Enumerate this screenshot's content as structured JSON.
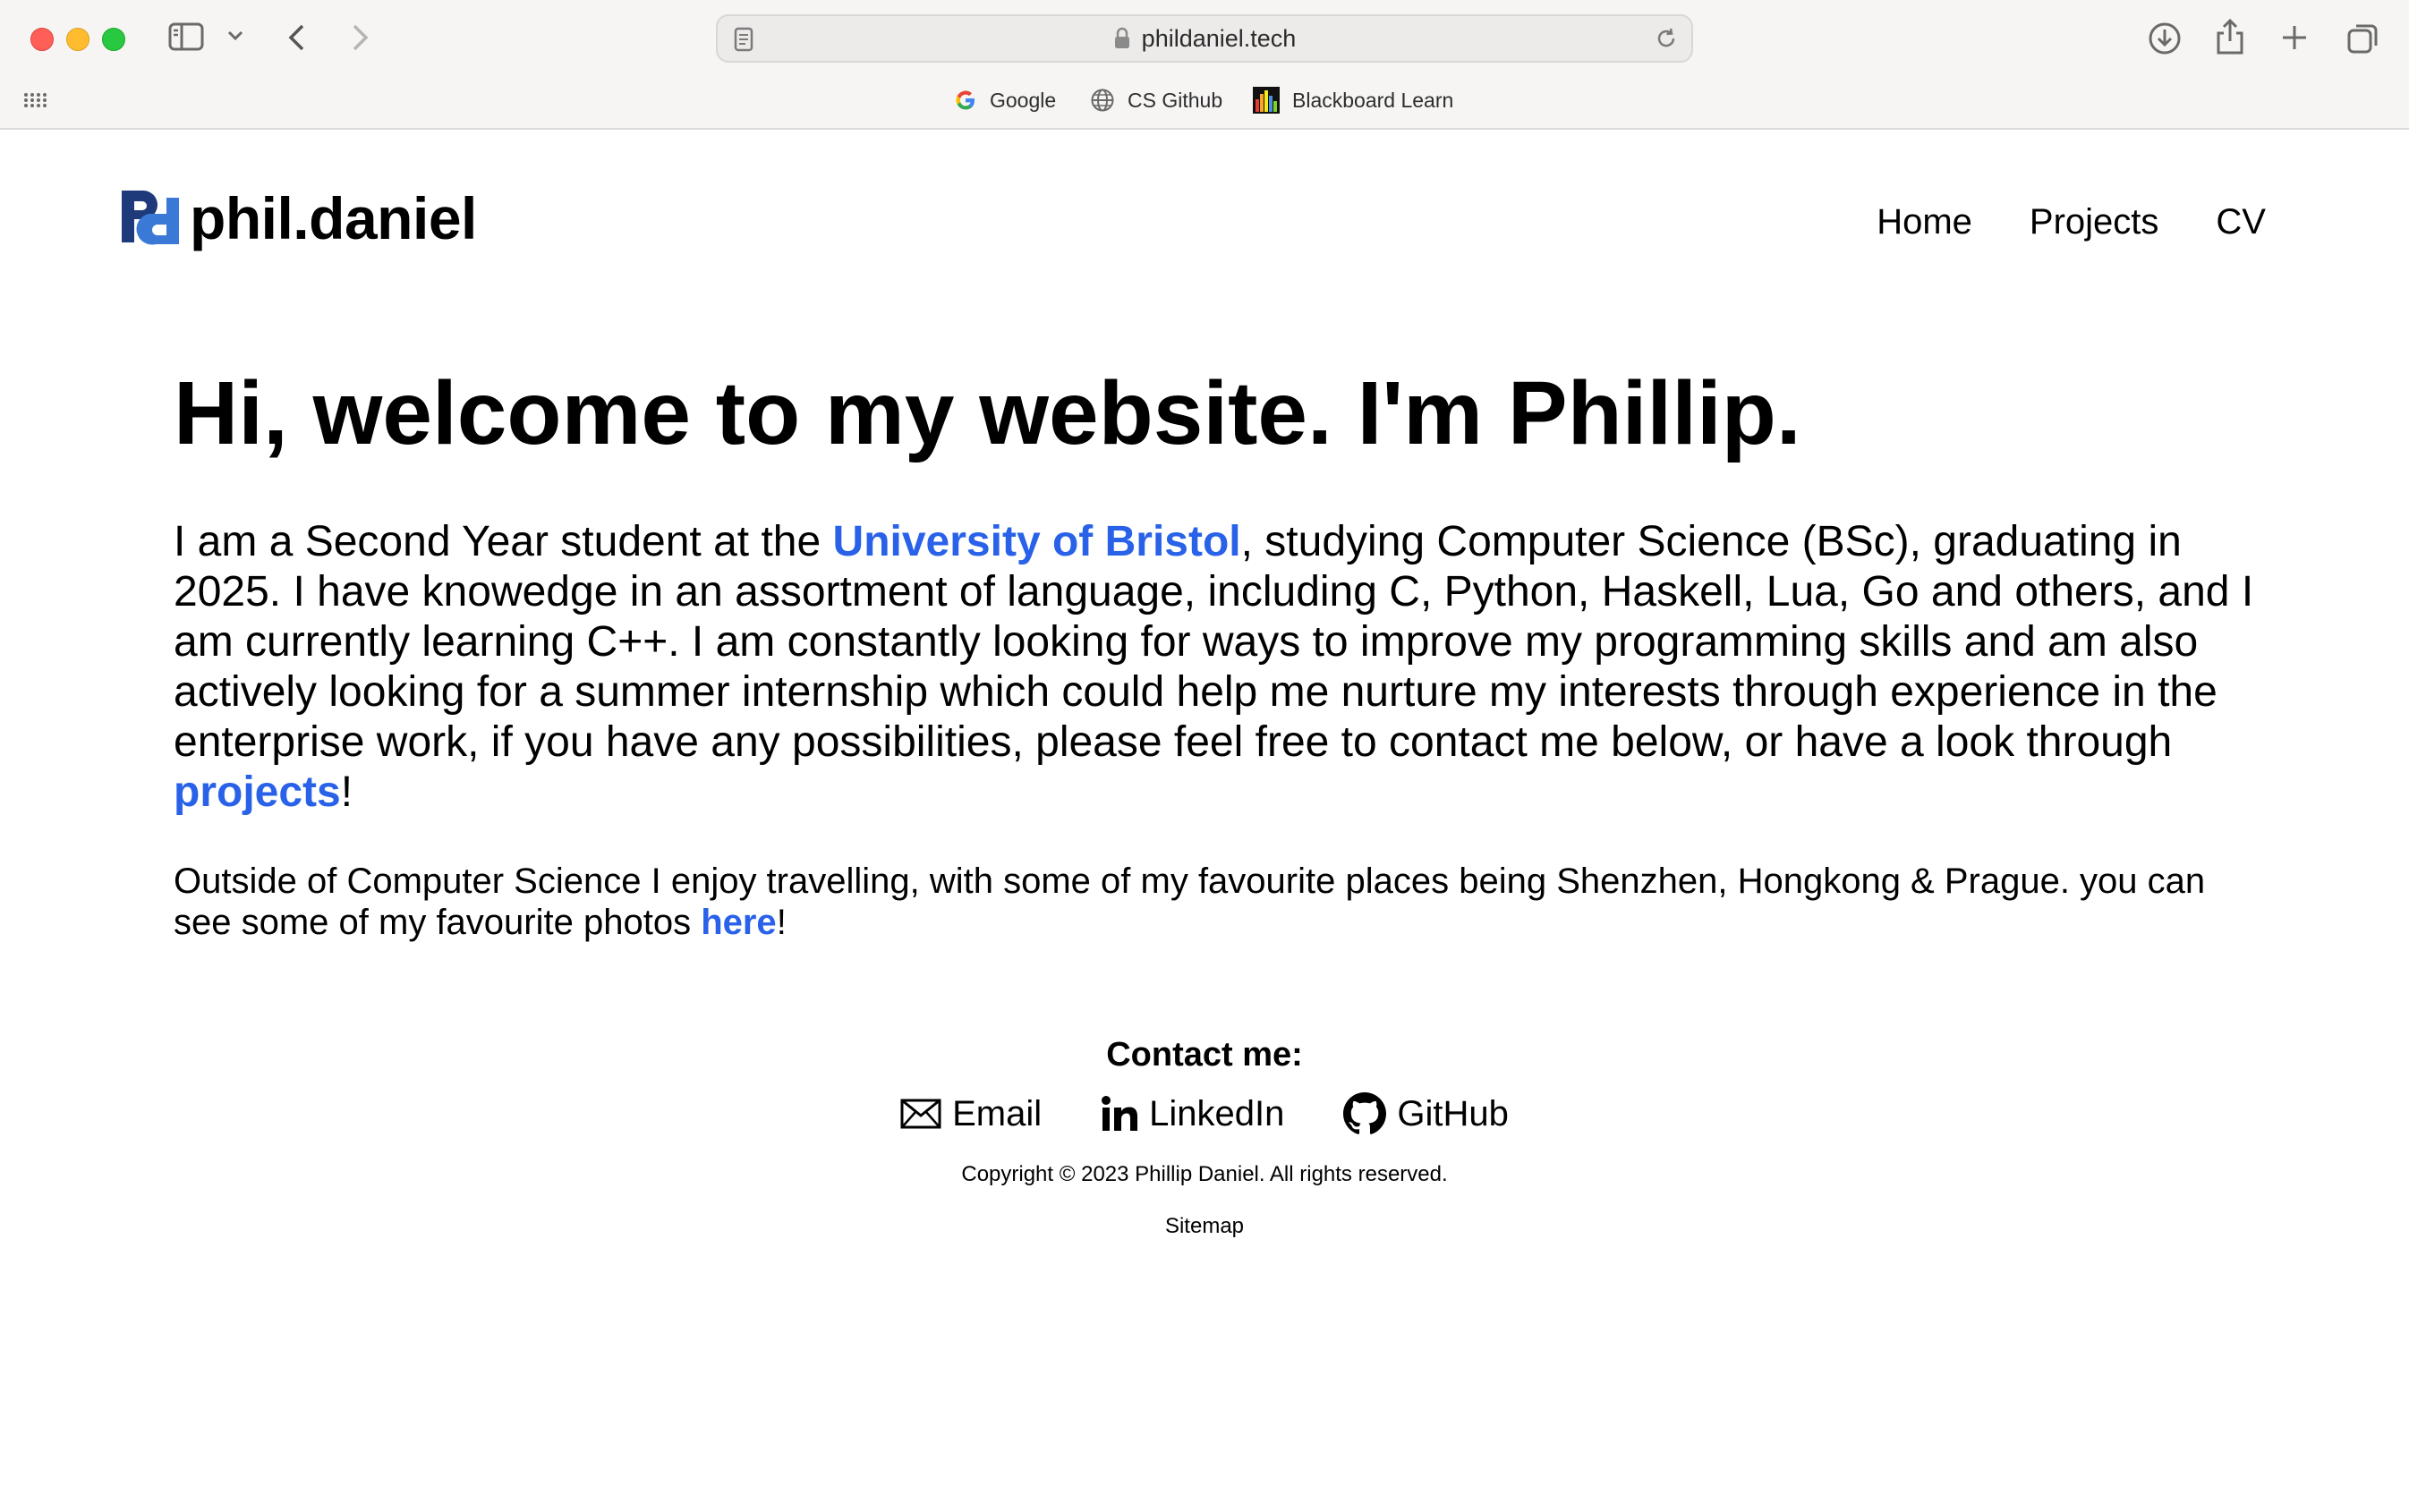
{
  "browser": {
    "url": "phildaniel.tech",
    "bookmarks": [
      {
        "label": "Google",
        "icon": "google-icon"
      },
      {
        "label": "CS Github",
        "icon": "globe-icon"
      },
      {
        "label": "Blackboard Learn",
        "icon": "blackboard-icon"
      }
    ]
  },
  "site": {
    "logo_text": "phil.daniel",
    "logo_mark": "Pd",
    "nav": [
      "Home",
      "Projects",
      "CV"
    ]
  },
  "main": {
    "heading": "Hi, welcome to my website. I'm Phillip.",
    "intro_before": "I am a Second Year student at the ",
    "intro_link": "University of Bristol",
    "intro_after": ", studying Computer Science (BSc), graduating in 2025. I have knowedge in an assortment of language, including C, Python, Haskell, Lua, Go and others, and I am currently learning C++. I am constantly looking for ways to improve my programming skills and am also actively looking for a summer internship which could help me nurture my interests through experience in the enterprise work, if you have any possibilities, please feel free to contact me below, or have a look through ",
    "projects_link": "projects",
    "intro_end": "!",
    "travel_before": "Outside of Computer Science I enjoy travelling, with some of my favourite places being Shenzhen, Hongkong & Prague. you can see some of my favourite photos ",
    "travel_link": "here",
    "travel_end": "!"
  },
  "contact": {
    "heading": "Contact me:",
    "email": "Email",
    "linkedin": "LinkedIn",
    "github": "GitHub"
  },
  "footer": {
    "copyright": "Copyright © 2023 Phillip Daniel. All rights reserved.",
    "sitemap": "Sitemap"
  },
  "colors": {
    "link": "#2962e8",
    "logo_dark": "#1e3a7a",
    "logo_light": "#3a7ad6"
  }
}
